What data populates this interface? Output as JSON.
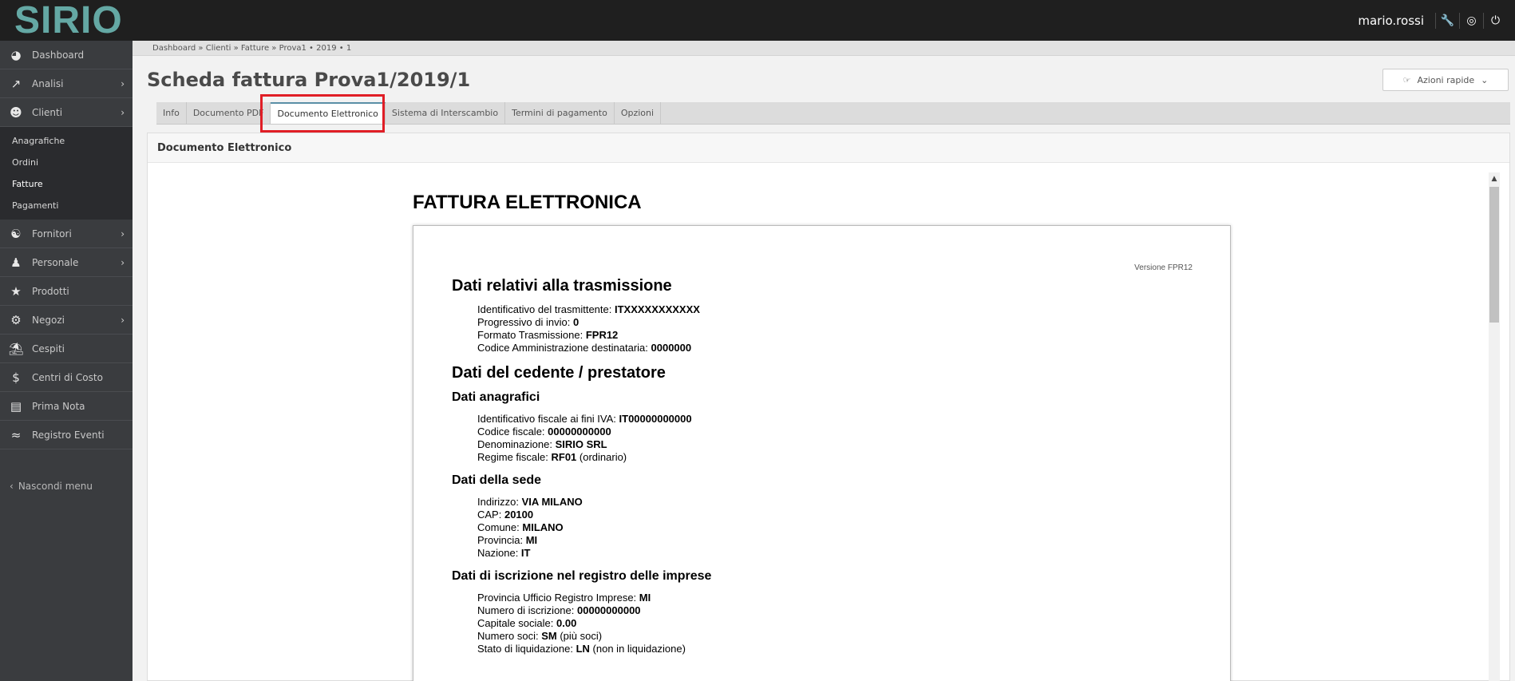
{
  "app": {
    "logo": "SIRIO",
    "username": "mario.rossi"
  },
  "topbar_icons": [
    "wrench-icon",
    "globe-icon",
    "power-icon"
  ],
  "sidebar": {
    "items": [
      {
        "label": "Dashboard",
        "icon": "dashboard-icon"
      },
      {
        "label": "Analisi",
        "icon": "chart-icon"
      },
      {
        "label": "Clienti",
        "icon": "user-icon"
      },
      {
        "label": "Fornitori",
        "icon": "users-icon"
      },
      {
        "label": "Personale",
        "icon": "person-icon"
      },
      {
        "label": "Prodotti",
        "icon": "star-icon"
      },
      {
        "label": "Negozi",
        "icon": "gear-icon"
      },
      {
        "label": "Cespiti",
        "icon": "bank-icon"
      },
      {
        "label": "Centri di Costo",
        "icon": "dollar-icon"
      },
      {
        "label": "Prima Nota",
        "icon": "book-icon"
      },
      {
        "label": "Registro Eventi",
        "icon": "rss-icon"
      }
    ],
    "clienti_sub": [
      "Anagrafiche",
      "Ordini",
      "Fatture",
      "Pagamenti"
    ],
    "hide_menu": "Nascondi menu"
  },
  "breadcrumb": "Dashboard » Clienti » Fatture » Prova1 • 2019 • 1",
  "page_title": "Scheda fattura Prova1/2019/1",
  "quick_actions": "Azioni rapide",
  "tabs": [
    "Info",
    "Documento PDF",
    "Documento Elettronico",
    "Sistema di Interscambio",
    "Termini di pagamento",
    "Opzioni"
  ],
  "panel_title": "Documento Elettronico",
  "document": {
    "title": "FATTURA ELETTRONICA",
    "version": "Versione FPR12",
    "trasmissione": {
      "heading": "Dati relativi alla trasmissione",
      "fields": [
        {
          "label": "Identificativo del trasmittente: ",
          "value": "ITXXXXXXXXXXX",
          "note": ""
        },
        {
          "label": "Progressivo di invio: ",
          "value": "0",
          "note": ""
        },
        {
          "label": "Formato Trasmissione: ",
          "value": "FPR12",
          "note": ""
        },
        {
          "label": "Codice Amministrazione destinataria: ",
          "value": "0000000",
          "note": ""
        }
      ]
    },
    "cedente_heading": "Dati del cedente / prestatore",
    "anagrafici": {
      "heading": "Dati anagrafici",
      "fields": [
        {
          "label": "Identificativo fiscale ai fini IVA: ",
          "value": "IT00000000000",
          "note": ""
        },
        {
          "label": "Codice fiscale: ",
          "value": "00000000000",
          "note": ""
        },
        {
          "label": "Denominazione: ",
          "value": "SIRIO SRL",
          "note": ""
        },
        {
          "label": "Regime fiscale: ",
          "value": "RF01",
          "note": " (ordinario)"
        }
      ]
    },
    "sede": {
      "heading": "Dati della sede",
      "fields": [
        {
          "label": "Indirizzo: ",
          "value": "VIA MILANO",
          "note": ""
        },
        {
          "label": "CAP: ",
          "value": "20100",
          "note": ""
        },
        {
          "label": "Comune: ",
          "value": "MILANO",
          "note": ""
        },
        {
          "label": "Provincia: ",
          "value": "MI",
          "note": ""
        },
        {
          "label": "Nazione: ",
          "value": "IT",
          "note": ""
        }
      ]
    },
    "iscrizione": {
      "heading": "Dati di iscrizione nel registro delle imprese",
      "fields": [
        {
          "label": "Provincia Ufficio Registro Imprese: ",
          "value": "MI",
          "note": ""
        },
        {
          "label": "Numero di iscrizione: ",
          "value": "00000000000",
          "note": ""
        },
        {
          "label": "Capitale sociale: ",
          "value": "0.00",
          "note": ""
        },
        {
          "label": "Numero soci: ",
          "value": "SM",
          "note": " (più soci)"
        },
        {
          "label": "Stato di liquidazione: ",
          "value": "LN",
          "note": " (non in liquidazione)"
        }
      ]
    }
  }
}
